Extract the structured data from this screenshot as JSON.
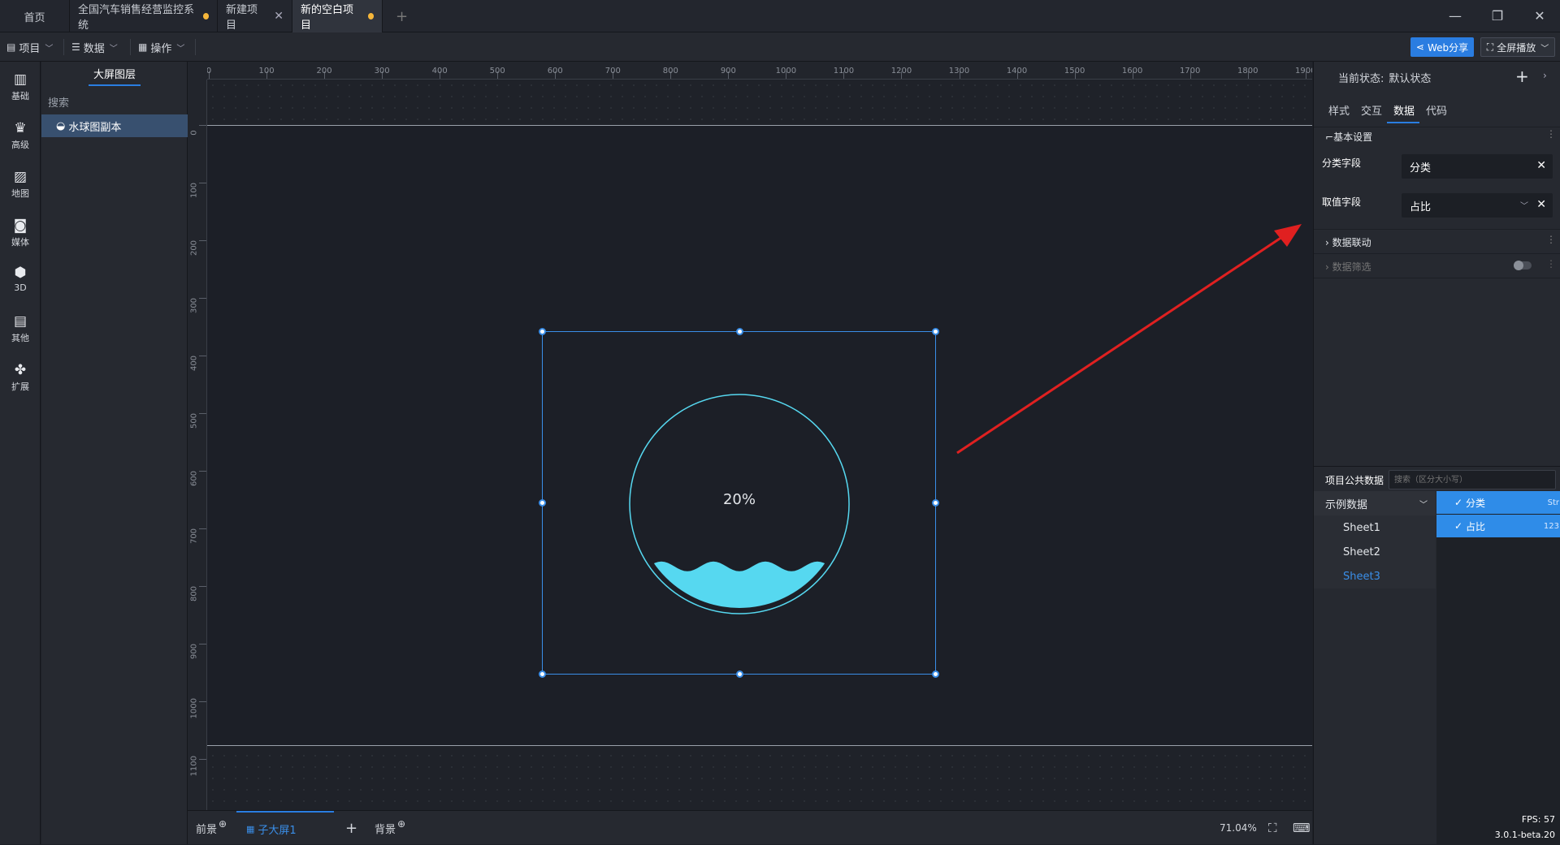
{
  "tabs": [
    {
      "label": "首页",
      "modified": false,
      "closable": false
    },
    {
      "label": "全国汽车销售经营监控系统",
      "modified": true,
      "closable": false
    },
    {
      "label": "新建项目",
      "modified": false,
      "closable": true
    },
    {
      "label": "新的空白项目",
      "modified": true,
      "closable": false,
      "active": true
    }
  ],
  "tab_add": "+",
  "window_controls": {
    "minimize": "—",
    "restore": "❐",
    "close": "✕"
  },
  "toolbar": {
    "project": "项目",
    "data": "数据",
    "operation": "操作",
    "web_share": "Web分享",
    "fullscreen": "全屏播放"
  },
  "left_nav": [
    {
      "label": "基础",
      "icon": "bar-chart-icon"
    },
    {
      "label": "高级",
      "icon": "crown-icon"
    },
    {
      "label": "地图",
      "icon": "map-icon"
    },
    {
      "label": "媒体",
      "icon": "camera-icon"
    },
    {
      "label": "3D",
      "icon": "cube-icon"
    },
    {
      "label": "其他",
      "icon": "list-icon"
    },
    {
      "label": "扩展",
      "icon": "puzzle-icon"
    }
  ],
  "layers": {
    "title": "大屏图层",
    "search_placeholder": "搜索",
    "items": [
      {
        "label": "水球图副本",
        "icon": "water-ball-icon"
      }
    ]
  },
  "ruler": {
    "h_ticks": [
      "0",
      "100",
      "200",
      "300",
      "400",
      "500",
      "600",
      "700",
      "800",
      "900",
      "1000",
      "1100",
      "1200",
      "1300",
      "1400",
      "1500",
      "1600",
      "1700",
      "1800",
      "1900"
    ],
    "v_ticks": [
      "0",
      "100",
      "200",
      "300",
      "400",
      "500",
      "600",
      "700",
      "800",
      "900",
      "1000",
      "1100"
    ]
  },
  "widget": {
    "value_text": "20%",
    "value": 0.2,
    "color": "#56d8f0"
  },
  "bottom": {
    "front": "前景",
    "sub_screen": "子大屏1",
    "background": "背景",
    "zoom": "71.04%",
    "fps": "FPS: 57",
    "version": "3.0.1-beta.20"
  },
  "right_panel": {
    "state_label": "当前状态:",
    "state_value": "默认状态",
    "tabs": [
      "样式",
      "交互",
      "数据",
      "代码"
    ],
    "active_tab": "数据",
    "basic_settings": "基本设置",
    "category_field_label": "分类字段",
    "category_field_value": "分类",
    "value_field_label": "取值字段",
    "value_field_value": "占比",
    "data_link": "数据联动",
    "data_filter": "数据筛选"
  },
  "public_data": {
    "title": "项目公共数据",
    "search_placeholder": "搜索（区分大小写）",
    "group": "示例数据",
    "sheets": [
      "Sheet1",
      "Sheet2",
      "Sheet3"
    ],
    "active_sheet": "Sheet3",
    "columns": [
      {
        "name": "分类",
        "type": "Str"
      },
      {
        "name": "占比",
        "type": "123"
      }
    ]
  },
  "colors": {
    "accent": "#2a7de1",
    "annotation": "#e02020",
    "modified_dot": "#f5b63a"
  }
}
